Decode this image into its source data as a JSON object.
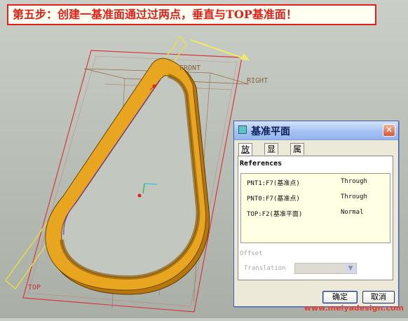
{
  "banner": {
    "text": "第五步：创建一基准面通过过两点，垂直与TOP基准面！"
  },
  "viewport": {
    "labels": {
      "front": "FRONT",
      "right": "RIGHT",
      "top": "TOP"
    },
    "colors": {
      "part": "#d9950c",
      "top_plane": "#d8383f",
      "datum_plane": "#e8e03a"
    }
  },
  "dialog": {
    "title": "基准平面",
    "close_label": "✕",
    "tabs": [
      {
        "label": "放置"
      },
      {
        "label": "显示"
      },
      {
        "label": "属性"
      }
    ],
    "references_header": "References",
    "references": [
      {
        "name": "PNT1:F7(基准点)",
        "type": "Through"
      },
      {
        "name": "PNT0:F7(基准点)",
        "type": "Through"
      },
      {
        "name": "TOP:F2(基准平面)",
        "type": "Normal"
      }
    ],
    "offset_label": "Offset",
    "translation_label": "Translation",
    "ok_label": "确定",
    "cancel_label": "取消"
  },
  "watermark": "www.meiyadesign.com"
}
